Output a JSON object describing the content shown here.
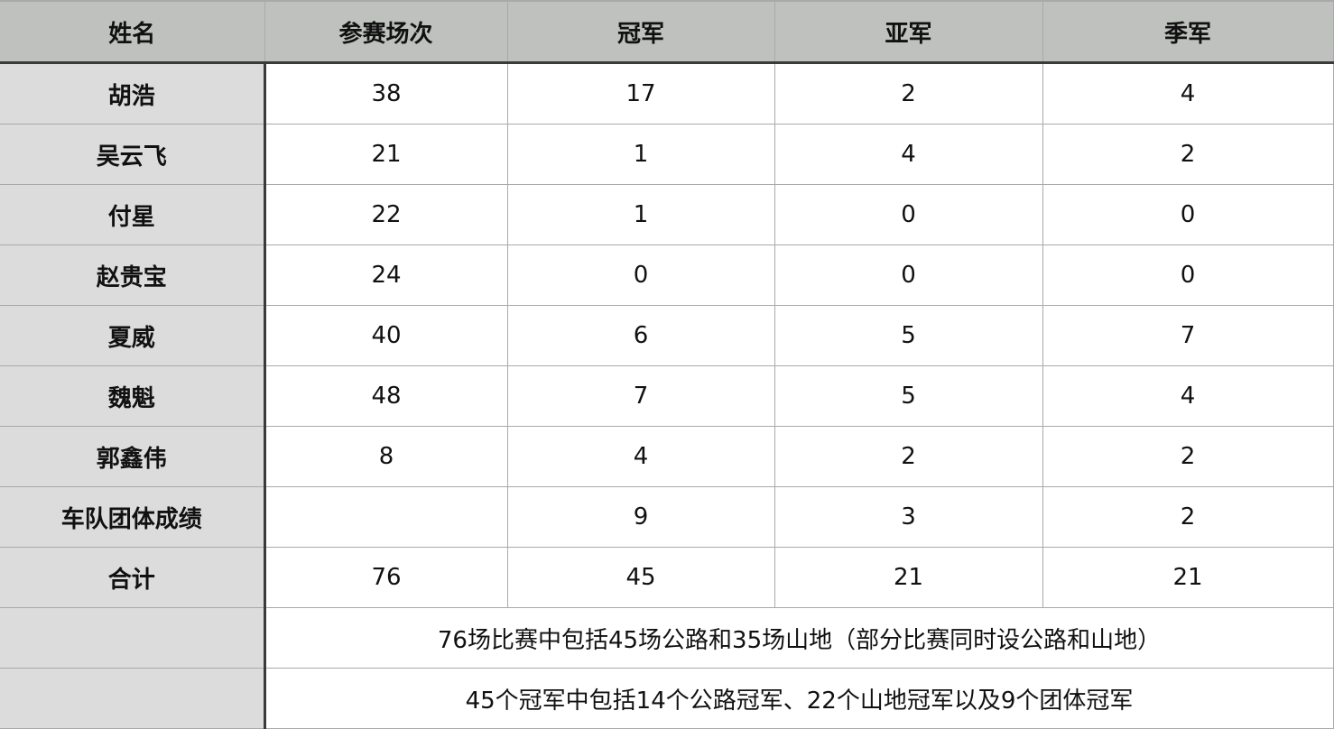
{
  "table": {
    "headers": [
      "姓名",
      "参赛场次",
      "冠军",
      "亚军",
      "季军"
    ],
    "rows": [
      {
        "name": "胡浩",
        "races": "38",
        "gold": "17",
        "silver": "2",
        "bronze": "4"
      },
      {
        "name": "吴云飞",
        "races": "21",
        "gold": "1",
        "silver": "4",
        "bronze": "2"
      },
      {
        "name": "付星",
        "races": "22",
        "gold": "1",
        "silver": "0",
        "bronze": "0"
      },
      {
        "name": "赵贵宝",
        "races": "24",
        "gold": "0",
        "silver": "0",
        "bronze": "0"
      },
      {
        "name": "夏威",
        "races": "40",
        "gold": "6",
        "silver": "5",
        "bronze": "7"
      },
      {
        "name": "魏魁",
        "races": "48",
        "gold": "7",
        "silver": "5",
        "bronze": "4"
      },
      {
        "name": "郭鑫伟",
        "races": "8",
        "gold": "4",
        "silver": "2",
        "bronze": "2"
      },
      {
        "name": "车队团体成绩",
        "races": "",
        "gold": "9",
        "silver": "3",
        "bronze": "2"
      },
      {
        "name": "合计",
        "races": "76",
        "gold": "45",
        "silver": "21",
        "bronze": "21"
      }
    ],
    "notes": [
      {
        "label": "",
        "text": "76场比赛中包括45场公路和35场山地（部分比赛同时设公路和山地）"
      },
      {
        "label": "",
        "text": "45个冠军中包括14个公路冠军、22个山地冠军以及9个团体冠军"
      }
    ]
  },
  "colors": {
    "header_bg": "#bfc1bf",
    "name_col_bg": "#dcdcdc",
    "cell_bg": "#ffffff",
    "grid_line": "#a9a9a9",
    "divider_line": "#3a3a3a"
  }
}
